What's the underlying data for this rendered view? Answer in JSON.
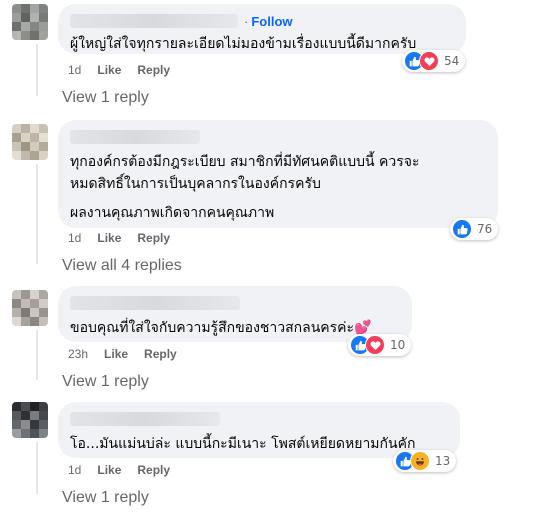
{
  "comments": [
    {
      "follow_label": "Follow",
      "text_lines": [
        "ผู้ใหญ่ใส่ใจทุกรายละเอียดไม่มองข้ามเรื่องแบบนี้ดีมากครับ"
      ],
      "time": "1d",
      "like_label": "Like",
      "reply_label": "Reply",
      "reaction_icons": [
        "like-icon",
        "love-icon"
      ],
      "reaction_count": "54",
      "replies_label": "View 1 reply"
    },
    {
      "text_lines": [
        "ทุกองค์กรต้องมีกฎระเบียบ สมาชิกที่มีทัศนคติแบบนี้ ควรจะ",
        "หมดสิทธิ์ในการเป็นบุคลากรในองค์กรครับ",
        "ผลงานคุณภาพเกิดจากคนคุณภาพ"
      ],
      "time": "1d",
      "like_label": "Like",
      "reply_label": "Reply",
      "reaction_icons": [
        "like-icon"
      ],
      "reaction_count": "76",
      "replies_label": "View all 4 replies"
    },
    {
      "text_lines": [
        "ขอบคุณที่ใส่ใจกับความรู้สึกของชาวสกลนครค่ะ"
      ],
      "emoji": "💕",
      "time": "23h",
      "like_label": "Like",
      "reply_label": "Reply",
      "reaction_icons": [
        "like-icon",
        "love-icon"
      ],
      "reaction_count": "10",
      "replies_label": "View 1 reply"
    },
    {
      "text_lines": [
        "โอ...มันแม่นบ่ล่ะ แบบนี้กะมีเนาะ โพสต์เหยียดหยามกันคัก"
      ],
      "time": "1d",
      "like_label": "Like",
      "reply_label": "Reply",
      "reaction_icons": [
        "like-icon",
        "haha-icon"
      ],
      "reaction_count": "13",
      "replies_label": "View 1 reply"
    }
  ],
  "colors": {
    "bubble": "#f0f2f5",
    "link": "#0866ff",
    "meta": "#65676b",
    "like": "#1877f2",
    "love": "#f33e58",
    "haha": "#f7b125"
  }
}
